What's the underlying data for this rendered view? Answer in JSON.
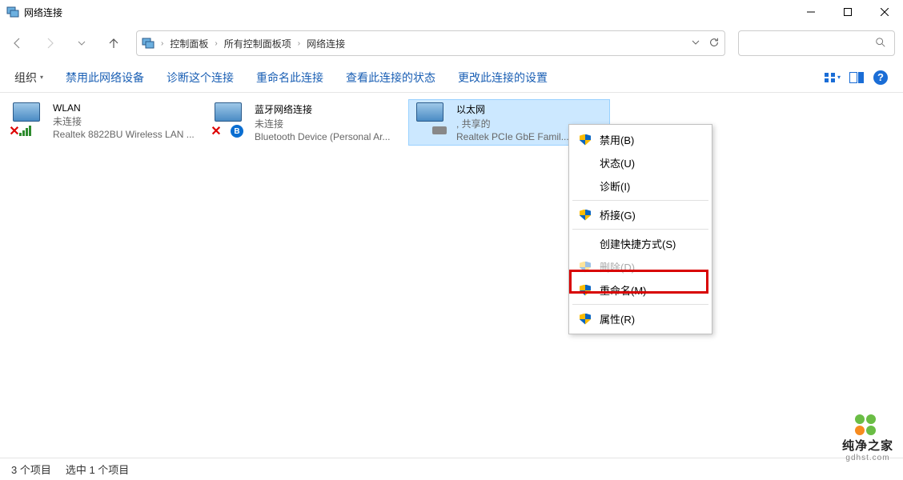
{
  "window": {
    "title": "网络连接"
  },
  "breadcrumbs": {
    "a": "控制面板",
    "b": "所有控制面板项",
    "c": "网络连接"
  },
  "toolbar": {
    "organize": "组织",
    "disable": "禁用此网络设备",
    "diagnose": "诊断这个连接",
    "rename": "重命名此连接",
    "status": "查看此连接的状态",
    "settings": "更改此连接的设置"
  },
  "adapters": [
    {
      "name": "WLAN",
      "state": "未连接",
      "device": "Realtek 8822BU Wireless LAN ..."
    },
    {
      "name": "蓝牙网络连接",
      "state": "未连接",
      "device": "Bluetooth Device (Personal Ar..."
    },
    {
      "name": "以太网",
      "state": ", 共享的",
      "device": "Realtek PCIe GbE Famil..."
    }
  ],
  "context_menu": {
    "disable": "禁用(B)",
    "status": "状态(U)",
    "diagnose": "诊断(I)",
    "bridge": "桥接(G)",
    "shortcut": "创建快捷方式(S)",
    "delete": "删除(D)",
    "rename": "重命名(M)",
    "properties": "属性(R)"
  },
  "statusbar": {
    "items": "3 个项目",
    "selected": "选中 1 个项目"
  },
  "watermark": {
    "text": "纯净之家",
    "url": "gdhst.com"
  }
}
